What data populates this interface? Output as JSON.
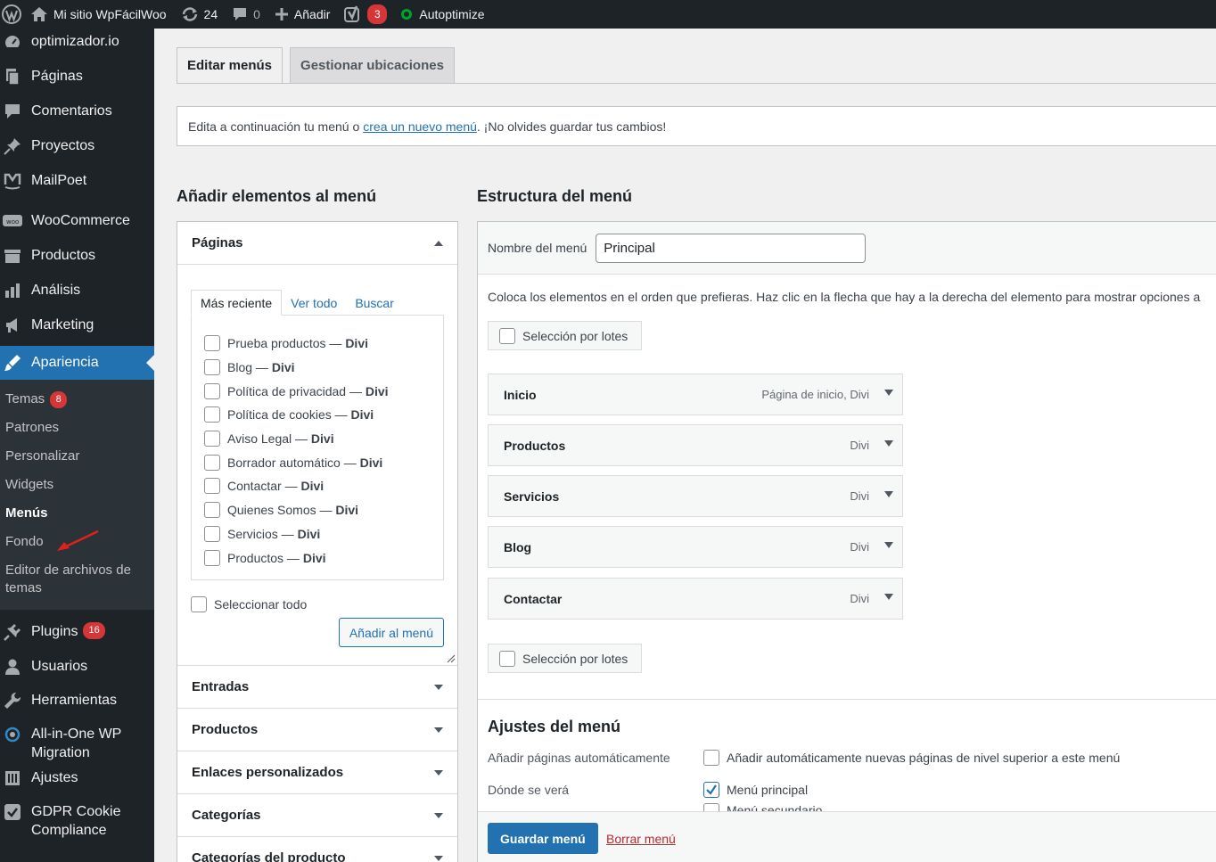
{
  "adminbar": {
    "site_name": "Mi sitio WpFácilWoo",
    "updates_count": "24",
    "comments_count": "0",
    "add_new": "Añadir",
    "yoast_badge": "3",
    "autoptimize": "Autoptimize"
  },
  "sidebar": {
    "items_top": [
      {
        "label": "optimizador.io",
        "icon": "gauge-icon"
      },
      {
        "label": "Páginas",
        "icon": "pages-icon"
      },
      {
        "label": "Comentarios",
        "icon": "comment-icon"
      },
      {
        "label": "Proyectos",
        "icon": "pin-icon"
      },
      {
        "label": "MailPoet",
        "icon": "mailpoet-icon"
      },
      {
        "label": "WooCommerce",
        "icon": "woocommerce-icon"
      },
      {
        "label": "Productos",
        "icon": "archive-icon"
      },
      {
        "label": "Análisis",
        "icon": "bar-chart-icon"
      },
      {
        "label": "Marketing",
        "icon": "megaphone-icon"
      }
    ],
    "current": {
      "label": "Apariencia",
      "icon": "brush-icon"
    },
    "submenu": {
      "temas": "Temas",
      "temas_badge": "8",
      "patrones": "Patrones",
      "personalizar": "Personalizar",
      "widgets": "Widgets",
      "menus": "Menús",
      "fondo": "Fondo",
      "editor": "Editor de archivos de temas"
    },
    "items_bottom": {
      "plugins": "Plugins",
      "plugins_badge": "16",
      "usuarios": "Usuarios",
      "herramientas": "Herramientas",
      "migration": "All-in-One WP Migration",
      "ajustes": "Ajustes",
      "gdpr": "GDPR Cookie Compliance"
    }
  },
  "tabs": {
    "edit": "Editar menús",
    "locations": "Gestionar ubicaciones"
  },
  "notice": {
    "before": "Edita a continuación tu menú o",
    "link": "crea un nuevo menú",
    "after": ". ¡No olvides guardar tus cambios!"
  },
  "add_items": {
    "title": "Añadir elementos al menú",
    "pages_section": "Páginas",
    "sub_tabs": {
      "recent": "Más reciente",
      "all": "Ver todo",
      "search": "Buscar"
    },
    "pages": [
      {
        "name": "Prueba productos",
        "theme": "Divi"
      },
      {
        "name": "Blog",
        "theme": "Divi"
      },
      {
        "name": "Política de privacidad",
        "theme": "Divi"
      },
      {
        "name": "Política de cookies",
        "theme": "Divi"
      },
      {
        "name": "Aviso Legal",
        "theme": "Divi"
      },
      {
        "name": "Borrador automático",
        "theme": "Divi"
      },
      {
        "name": "Contactar",
        "theme": "Divi"
      },
      {
        "name": "Quienes Somos",
        "theme": "Divi"
      },
      {
        "name": "Servicios",
        "theme": "Divi"
      },
      {
        "name": "Productos",
        "theme": "Divi"
      }
    ],
    "select_all": "Seleccionar todo",
    "add_button": "Añadir al menú",
    "sections": [
      "Entradas",
      "Productos",
      "Enlaces personalizados",
      "Categorías",
      "Categorías del producto"
    ]
  },
  "structure": {
    "title": "Estructura del menú",
    "name_label": "Nombre del menú",
    "name_value": "Principal",
    "description": "Coloca los elementos en el orden que prefieras. Haz clic en la flecha que hay a la derecha del elemento para mostrar opciones a",
    "bulk_select": "Selección por lotes",
    "items": [
      {
        "title": "Inicio",
        "meta": "Página de inicio, Divi"
      },
      {
        "title": "Productos",
        "meta": "Divi"
      },
      {
        "title": "Servicios",
        "meta": "Divi"
      },
      {
        "title": "Blog",
        "meta": "Divi"
      },
      {
        "title": "Contactar",
        "meta": "Divi"
      }
    ],
    "settings_title": "Ajustes del menú",
    "auto_add_label": "Añadir páginas automáticamente",
    "auto_add_option": "Añadir automáticamente nuevas páginas de nivel superior a este menú",
    "location_label": "Dónde se verá",
    "location_primary": "Menú principal",
    "location_secondary": "Menú secundario",
    "save_button": "Guardar menú",
    "delete_link": "Borrar menú"
  },
  "colors": {
    "accent": "#2271b1",
    "sidebar_bg": "#1d2327",
    "badge": "#d63638",
    "arrow_annotation": "#e02020"
  }
}
